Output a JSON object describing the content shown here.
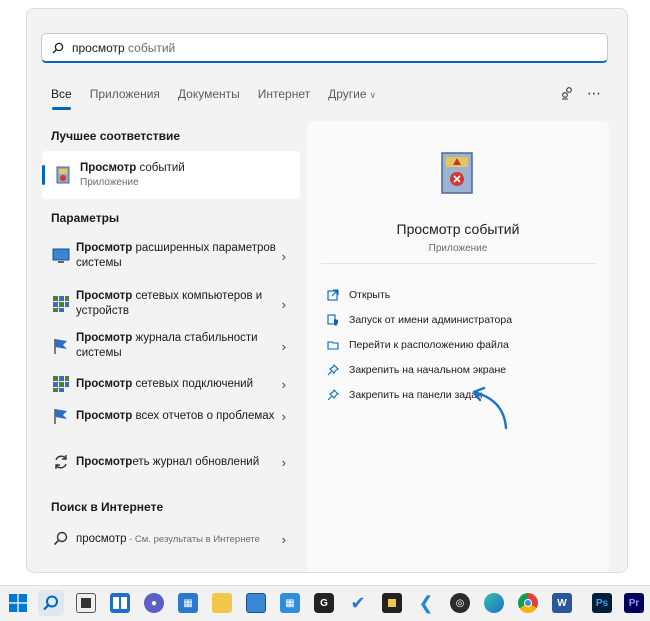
{
  "search": {
    "query_bold": "просмотр",
    "query_rest": " событий"
  },
  "tabs": [
    {
      "label": "Все",
      "active": true
    },
    {
      "label": "Приложения"
    },
    {
      "label": "Документы"
    },
    {
      "label": "Интернет"
    },
    {
      "label": "Другие"
    }
  ],
  "best_match": {
    "section": "Лучшее соответствие",
    "title_bold": "Просмотр",
    "title_rest": " событий",
    "subtitle": "Приложение"
  },
  "settings": {
    "section": "Параметры",
    "items": [
      {
        "bold": "Просмотр",
        "rest": " расширенных параметров системы"
      },
      {
        "bold": "Просмотр",
        "rest": " сетевых компьютеров и устройств"
      },
      {
        "bold": "Просмотр",
        "rest": " журнала стабильности системы"
      },
      {
        "bold": "Просмотр",
        "rest": " сетевых подключений"
      },
      {
        "bold": "Просмотр",
        "rest": " всех отчетов о проблемах"
      },
      {
        "bold": "Просмотр",
        "rest": "еть журнал обновлений"
      }
    ]
  },
  "web": {
    "section": "Поиск в Интернете",
    "query": "просмотр",
    "hint": " - См. результаты в Интернете"
  },
  "preview": {
    "title": "Просмотр событий",
    "subtitle": "Приложение",
    "actions": [
      {
        "label": "Открыть",
        "icon": "open-icon"
      },
      {
        "label": "Запуск от имени администратора",
        "icon": "shield-icon"
      },
      {
        "label": "Перейти к расположению файла",
        "icon": "folder-icon"
      },
      {
        "label": "Закрепить на начальном экране",
        "icon": "pin-icon"
      },
      {
        "label": "Закрепить на панели задач",
        "icon": "pin-icon"
      }
    ]
  },
  "taskbar": {
    "colors": {
      "accent": "#0067c0",
      "annotation_arrow": "#1a73c9"
    }
  }
}
